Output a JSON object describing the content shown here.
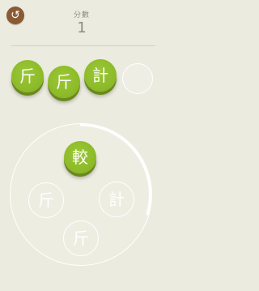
{
  "header": {
    "back_icon": "↺",
    "score_label": "分數",
    "score_value": "1"
  },
  "answer_slots": [
    {
      "char": "斤",
      "state": "filled"
    },
    {
      "char": "斤",
      "state": "filled"
    },
    {
      "char": "計",
      "state": "filled"
    },
    {
      "char": "",
      "state": "empty"
    }
  ],
  "wheel": {
    "center": "較",
    "choices": [
      "斤",
      "計",
      "斤"
    ]
  },
  "colors": {
    "background": "#ecebdf",
    "tile_green": "#8dbb29",
    "back_button": "#8a5a36",
    "text_muted": "#8b8b82"
  }
}
